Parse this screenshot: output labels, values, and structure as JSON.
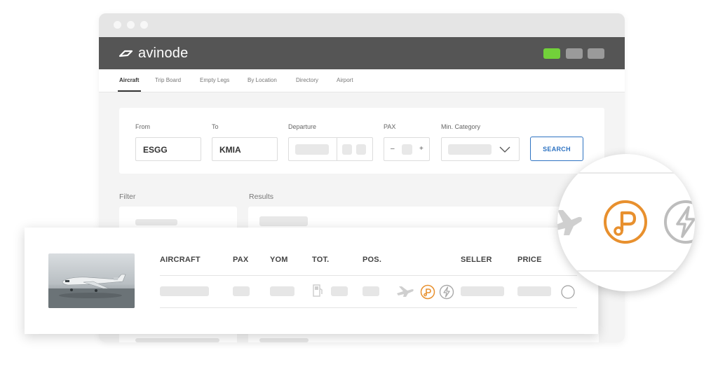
{
  "app": {
    "brand": "avinode",
    "colors": {
      "header_bg": "#555555",
      "accent_green": "#72d13a",
      "button_blue": "#2e73c2",
      "icon_orange": "#e8902e",
      "icon_gray": "#bdbdbd"
    }
  },
  "nav": {
    "tabs": [
      {
        "label": "Aircraft",
        "active": true
      },
      {
        "label": "Trip Board",
        "active": false
      },
      {
        "label": "Empty Legs",
        "active": false
      },
      {
        "label": "By Location",
        "active": false
      },
      {
        "label": "Directory",
        "active": false
      },
      {
        "label": "Airport",
        "active": false
      }
    ]
  },
  "search": {
    "from_label": "From",
    "from_value": "ESGG",
    "to_label": "To",
    "to_value": "KMIA",
    "departure_label": "Departure",
    "pax_label": "PAX",
    "pax_minus": "–",
    "pax_plus": "+",
    "category_label": "Min. Category",
    "button_label": "SEARCH"
  },
  "sections": {
    "filter_label": "Filter",
    "results_label": "Results"
  },
  "results": {
    "columns": [
      "AIRCRAFT",
      "PAX",
      "YOM",
      "TOT.",
      "POS.",
      "SELLER",
      "PRICE"
    ],
    "row_icons": [
      "plane-icon",
      "p-badge-icon",
      "lightning-icon",
      "select-radio"
    ]
  },
  "magnifier": {
    "icons": [
      "plane-icon",
      "p-badge-icon",
      "lightning-icon"
    ]
  }
}
